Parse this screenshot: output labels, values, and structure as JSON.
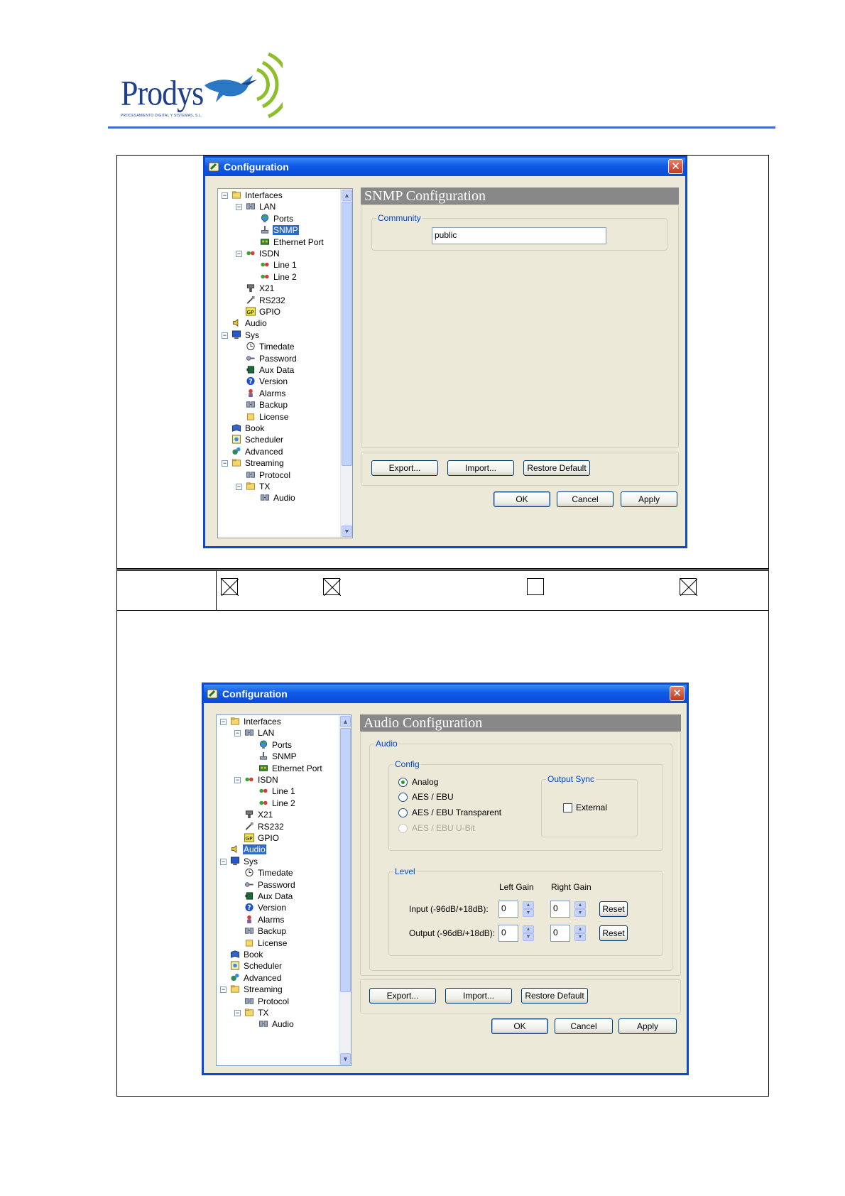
{
  "logo": {
    "name": "Prodys",
    "subtitle": "PROCESAMIENTO DIGITAL Y SISTEMAS, S.L."
  },
  "colors": {
    "rule": "#3f6bd3",
    "title_bar": "#0a4ad6",
    "selection": "#316ac5",
    "group_title": "#0046d5"
  },
  "window1": {
    "title": "Configuration",
    "tree": [
      {
        "label": "Interfaces",
        "icon": "folder-icon"
      },
      {
        "label": "LAN",
        "icon": "network-icon"
      },
      {
        "label": "Ports",
        "icon": "globe-icon"
      },
      {
        "label": "SNMP",
        "icon": "snmp-icon",
        "selected": true
      },
      {
        "label": "Ethernet Port",
        "icon": "ethernet-card-icon"
      },
      {
        "label": "ISDN",
        "icon": "isdn-icon"
      },
      {
        "label": "Line 1",
        "icon": "line-icon"
      },
      {
        "label": "Line 2",
        "icon": "line-icon"
      },
      {
        "label": "X21",
        "icon": "connector-icon"
      },
      {
        "label": "RS232",
        "icon": "serial-icon"
      },
      {
        "label": "GPIO",
        "icon": "gpio-icon"
      },
      {
        "label": "Audio",
        "icon": "speaker-icon"
      },
      {
        "label": "Sys",
        "icon": "monitor-icon"
      },
      {
        "label": "Timedate",
        "icon": "clock-icon"
      },
      {
        "label": "Password",
        "icon": "key-icon"
      },
      {
        "label": "Aux Data",
        "icon": "aux-data-icon"
      },
      {
        "label": "Version",
        "icon": "help-icon"
      },
      {
        "label": "Alarms",
        "icon": "alarm-icon"
      },
      {
        "label": "Backup",
        "icon": "network-icon"
      },
      {
        "label": "License",
        "icon": "license-icon"
      },
      {
        "label": "Book",
        "icon": "book-icon"
      },
      {
        "label": "Scheduler",
        "icon": "scheduler-icon"
      },
      {
        "label": "Advanced",
        "icon": "advanced-icon"
      },
      {
        "label": "Streaming",
        "icon": "folder-icon"
      },
      {
        "label": "Protocol",
        "icon": "network-icon"
      },
      {
        "label": "TX",
        "icon": "folder-icon"
      },
      {
        "label": "Audio",
        "icon": "network-icon"
      }
    ],
    "panel_title": "SNMP Configuration",
    "community_group": "Community",
    "community_value": "public",
    "buttons": {
      "export": "Export...",
      "import": "Import...",
      "restore": "Restore Default",
      "ok": "OK",
      "cancel": "Cancel",
      "apply": "Apply"
    }
  },
  "checkboxes": [
    {
      "checked": true
    },
    {
      "checked": true
    },
    {
      "checked": false
    },
    {
      "checked": true
    }
  ],
  "window2": {
    "title": "Configuration",
    "tree": [
      {
        "label": "Interfaces",
        "icon": "folder-icon"
      },
      {
        "label": "LAN",
        "icon": "network-icon"
      },
      {
        "label": "Ports",
        "icon": "globe-icon"
      },
      {
        "label": "SNMP",
        "icon": "snmp-icon"
      },
      {
        "label": "Ethernet Port",
        "icon": "ethernet-card-icon"
      },
      {
        "label": "ISDN",
        "icon": "isdn-icon"
      },
      {
        "label": "Line 1",
        "icon": "line-icon"
      },
      {
        "label": "Line 2",
        "icon": "line-icon"
      },
      {
        "label": "X21",
        "icon": "connector-icon"
      },
      {
        "label": "RS232",
        "icon": "serial-icon"
      },
      {
        "label": "GPIO",
        "icon": "gpio-icon"
      },
      {
        "label": "Audio",
        "icon": "speaker-icon",
        "selected": true
      },
      {
        "label": "Sys",
        "icon": "monitor-icon"
      },
      {
        "label": "Timedate",
        "icon": "clock-icon"
      },
      {
        "label": "Password",
        "icon": "key-icon"
      },
      {
        "label": "Aux Data",
        "icon": "aux-data-icon"
      },
      {
        "label": "Version",
        "icon": "help-icon"
      },
      {
        "label": "Alarms",
        "icon": "alarm-icon"
      },
      {
        "label": "Backup",
        "icon": "network-icon"
      },
      {
        "label": "License",
        "icon": "license-icon"
      },
      {
        "label": "Book",
        "icon": "book-icon"
      },
      {
        "label": "Scheduler",
        "icon": "scheduler-icon"
      },
      {
        "label": "Advanced",
        "icon": "advanced-icon"
      },
      {
        "label": "Streaming",
        "icon": "folder-icon"
      },
      {
        "label": "Protocol",
        "icon": "network-icon"
      },
      {
        "label": "TX",
        "icon": "folder-icon"
      },
      {
        "label": "Audio",
        "icon": "network-icon"
      }
    ],
    "panel_title": "Audio Configuration",
    "audio_group": "Audio",
    "config_group": "Config",
    "radios": [
      {
        "label": "Analog",
        "selected": true,
        "disabled": false
      },
      {
        "label": "AES / EBU",
        "selected": false,
        "disabled": false
      },
      {
        "label": "AES / EBU Transparent",
        "selected": false,
        "disabled": false
      },
      {
        "label": "AES / EBU U-Bit",
        "selected": false,
        "disabled": true
      }
    ],
    "output_sync_group": "Output Sync",
    "external_label": "External",
    "external_checked": false,
    "level_group": "Level",
    "left_gain": "Left Gain",
    "right_gain": "Right Gain",
    "input_label": "Input (-96dB/+18dB):",
    "output_label": "Output (-96dB/+18dB):",
    "input_left": "0",
    "input_right": "0",
    "output_left": "0",
    "output_right": "0",
    "reset": "Reset",
    "buttons": {
      "export": "Export...",
      "import": "Import...",
      "restore": "Restore Default",
      "ok": "OK",
      "cancel": "Cancel",
      "apply": "Apply"
    }
  }
}
